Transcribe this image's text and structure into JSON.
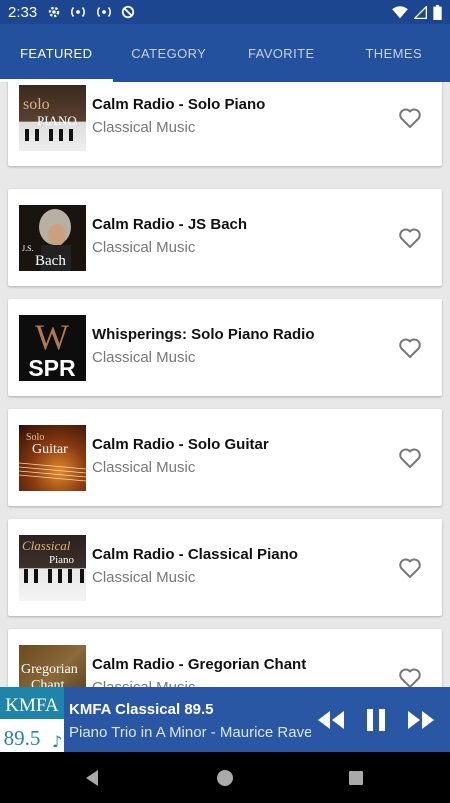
{
  "status_bar": {
    "time": "2:33"
  },
  "tabs": [
    {
      "label": "FEATURED",
      "active": true
    },
    {
      "label": "CATEGORY",
      "active": false
    },
    {
      "label": "FAVORITE",
      "active": false
    },
    {
      "label": "THEMES",
      "active": false
    }
  ],
  "stations": [
    {
      "title": "Calm Radio - Solo Piano",
      "genre": "Classical Music",
      "thumb_text": [
        "solo",
        "PIANO"
      ]
    },
    {
      "title": "Calm Radio - JS Bach",
      "genre": "Classical Music",
      "thumb_text": [
        "J.S.",
        "Bach"
      ]
    },
    {
      "title": "Whisperings: Solo Piano Radio",
      "genre": "Classical Music",
      "thumb_text": [
        "W",
        "SPR"
      ]
    },
    {
      "title": "Calm Radio - Solo Guitar",
      "genre": "Classical Music",
      "thumb_text": [
        "Solo",
        "Guitar"
      ]
    },
    {
      "title": "Calm Radio - Classical Piano",
      "genre": "Classical Music",
      "thumb_text": [
        "Classical",
        "Piano"
      ]
    },
    {
      "title": "Calm Radio - Gregorian Chant",
      "genre": "Classical Music",
      "thumb_text": [
        "Gregorian",
        "Chant"
      ]
    }
  ],
  "player": {
    "logo_text": [
      "KMFA",
      "89.5"
    ],
    "title": "KMFA Classical 89.5",
    "subtitle": "Piano Trio in A Minor - Maurice Ravel"
  },
  "colors": {
    "appbar": "#23519e",
    "statusbar": "#1d4690",
    "player": "#2a57a4"
  }
}
